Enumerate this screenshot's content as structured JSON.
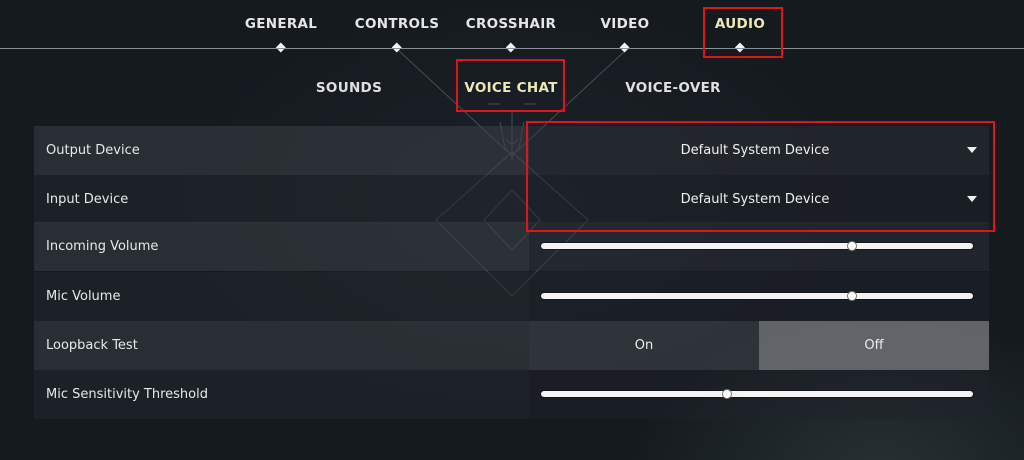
{
  "top_nav": {
    "tabs": [
      {
        "label": "GENERAL",
        "active": false
      },
      {
        "label": "CONTROLS",
        "active": false
      },
      {
        "label": "CROSSHAIR",
        "active": false
      },
      {
        "label": "VIDEO",
        "active": false
      },
      {
        "label": "AUDIO",
        "active": true
      }
    ]
  },
  "sub_nav": {
    "tabs": [
      {
        "label": "SOUNDS",
        "active": false
      },
      {
        "label": "VOICE CHAT",
        "active": true
      },
      {
        "label": "VOICE-OVER",
        "active": false
      }
    ]
  },
  "settings": {
    "output_device": {
      "label": "Output Device",
      "value": "Default System Device"
    },
    "input_device": {
      "label": "Input Device",
      "value": "Default System Device"
    },
    "incoming_volume": {
      "label": "Incoming Volume",
      "level": 0.72
    },
    "mic_volume": {
      "label": "Mic Volume",
      "level": 0.72
    },
    "loopback_test": {
      "label": "Loopback Test",
      "on_label": "On",
      "off_label": "Off",
      "selected": "Off"
    },
    "mic_sensitivity": {
      "label": "Mic Sensitivity Threshold",
      "level": 0.43
    }
  },
  "colors": {
    "active_tab_text": "#ece8b8",
    "highlight_box": "#e0141b"
  }
}
